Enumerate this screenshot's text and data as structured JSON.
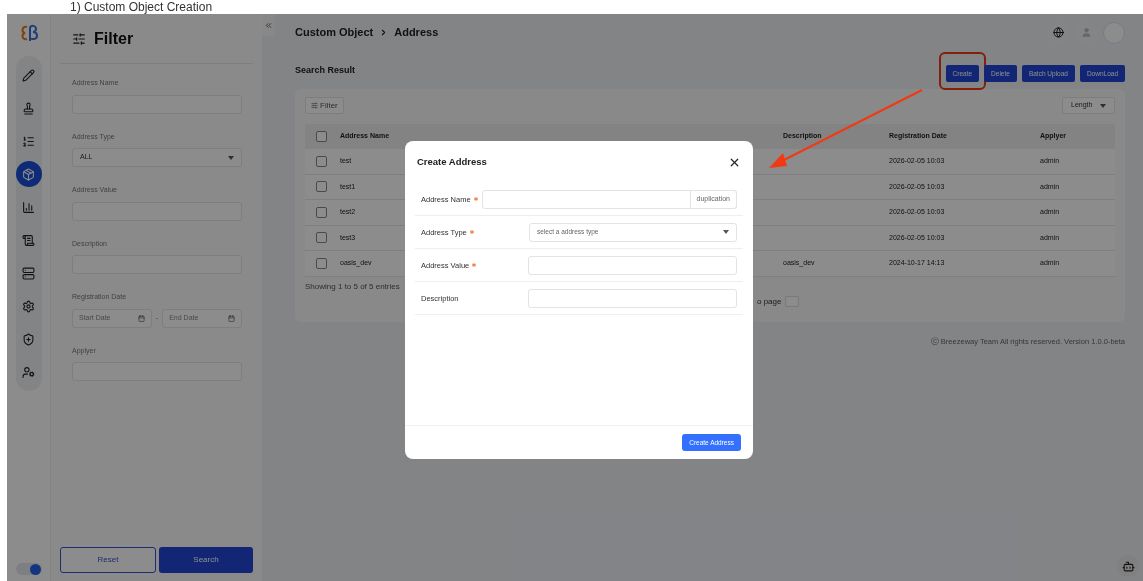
{
  "doc_heading": "1) Custom Object Creation",
  "nav": [
    {
      "selected": false
    },
    {
      "selected": false
    },
    {
      "selected": false
    },
    {
      "selected": true
    },
    {
      "selected": false
    },
    {
      "selected": false
    },
    {
      "selected": false
    },
    {
      "selected": false
    },
    {
      "selected": false
    },
    {
      "selected": false
    }
  ],
  "theme_toggle": {
    "on": true
  },
  "filter_panel": {
    "title": "Filter",
    "fields": [
      {
        "kind": "text",
        "label": "Address Name"
      },
      {
        "kind": "select",
        "label": "Address Type",
        "value": "ALL"
      },
      {
        "kind": "text",
        "label": "Address Value"
      },
      {
        "kind": "text",
        "label": "Description"
      },
      {
        "kind": "daterange",
        "label": "Registration Date",
        "start_placeholder": "Start Date",
        "separator": "-",
        "end_placeholder": "End Date"
      },
      {
        "kind": "text",
        "label": "Applyer"
      }
    ],
    "buttons": [
      "Reset",
      "Search"
    ]
  },
  "breadcrumb": [
    "Custom Object",
    "Address"
  ],
  "section_title": "Search Result",
  "actions": [
    {
      "label": "Create",
      "highlighted": true
    },
    {
      "label": "Delete",
      "highlighted": false
    },
    {
      "label": "Batch Upload",
      "highlighted": false
    },
    {
      "label": "DownLoad",
      "highlighted": false
    }
  ],
  "filter_button": "Filter",
  "length_select": "Length",
  "table": {
    "header_checked": false,
    "columns": [
      "Address Name",
      "Description",
      "Registration Date",
      "Applyer"
    ],
    "rows": [
      {
        "checked": false,
        "address_name": "test",
        "registration_date": "2026-02-05 10:03",
        "applyer": "admin"
      },
      {
        "checked": false,
        "address_name": "test1",
        "registration_date": "2026-02-05 10:03",
        "applyer": "admin"
      },
      {
        "checked": false,
        "address_name": "test2",
        "registration_date": "2026-02-05 10:03",
        "applyer": "admin"
      },
      {
        "checked": false,
        "address_name": "test3",
        "registration_date": "2026-02-05 10:03",
        "applyer": "admin"
      },
      {
        "checked": false,
        "address_name": "oasis_dev",
        "description": "oasis_dev",
        "registration_date": "2024-10-17 14:13",
        "applyer": "admin"
      }
    ]
  },
  "entries_info": "Showing 1 to 5 of 5 entries",
  "pagination_text": "o page",
  "footer": "ⓒ Breezeway Team All rights reserved. Version 1.0.0-beta",
  "modal": {
    "title": "Create Address",
    "fields": [
      {
        "kind": "text",
        "label": "Address Name",
        "required": true,
        "addon": "duplication"
      },
      {
        "kind": "select",
        "label": "Address Type",
        "required": true,
        "placeholder": "select a address type"
      },
      {
        "kind": "text",
        "label": "Address Value",
        "required": true
      },
      {
        "kind": "text",
        "label": "Description",
        "required": false
      }
    ],
    "submit": "Create Address"
  }
}
